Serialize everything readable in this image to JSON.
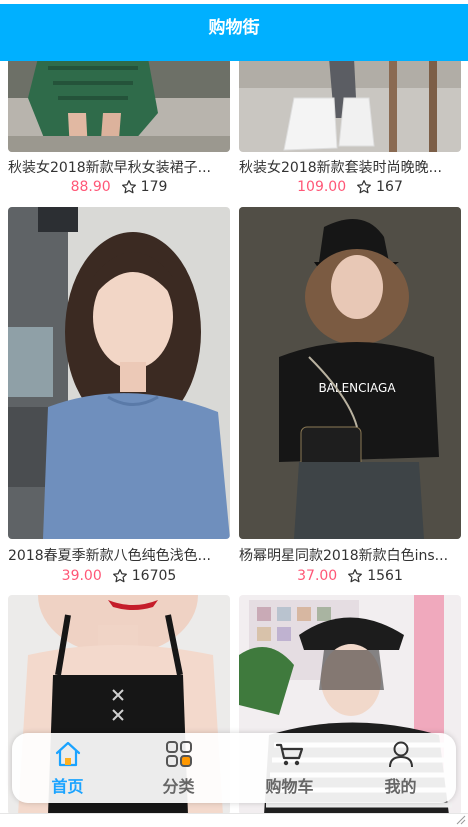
{
  "nav": {
    "title": "购物街"
  },
  "colors": {
    "brand": "#00b0ff",
    "price": "#ff5777",
    "active_tab": "#1aa3ff",
    "inactive_tab": "#666666"
  },
  "goods": [
    {
      "title": "秋装女2018新款早秋女装裙子...",
      "price": "88.90",
      "collect": "179",
      "icon": "star-icon"
    },
    {
      "title": "秋装女2018新款套装时尚晚晚...",
      "price": "109.00",
      "collect": "167",
      "icon": "star-icon"
    },
    {
      "title": "2018春夏季新款八色纯色浅色...",
      "price": "39.00",
      "collect": "16705",
      "icon": "star-icon"
    },
    {
      "title": "杨幂明星同款2018新款白色ins...",
      "price": "37.00",
      "collect": "1561",
      "icon": "star-icon"
    },
    {
      "title": "",
      "price": "",
      "collect": "",
      "icon": "star-icon"
    },
    {
      "title": "",
      "price": "",
      "collect": "",
      "icon": "star-icon"
    }
  ],
  "tabbar": {
    "items": [
      {
        "label": "首页",
        "icon": "home-icon",
        "active": true
      },
      {
        "label": "分类",
        "icon": "category-icon",
        "active": false
      },
      {
        "label": "购物车",
        "icon": "cart-icon",
        "active": false
      },
      {
        "label": "我的",
        "icon": "profile-icon",
        "active": false
      }
    ]
  }
}
